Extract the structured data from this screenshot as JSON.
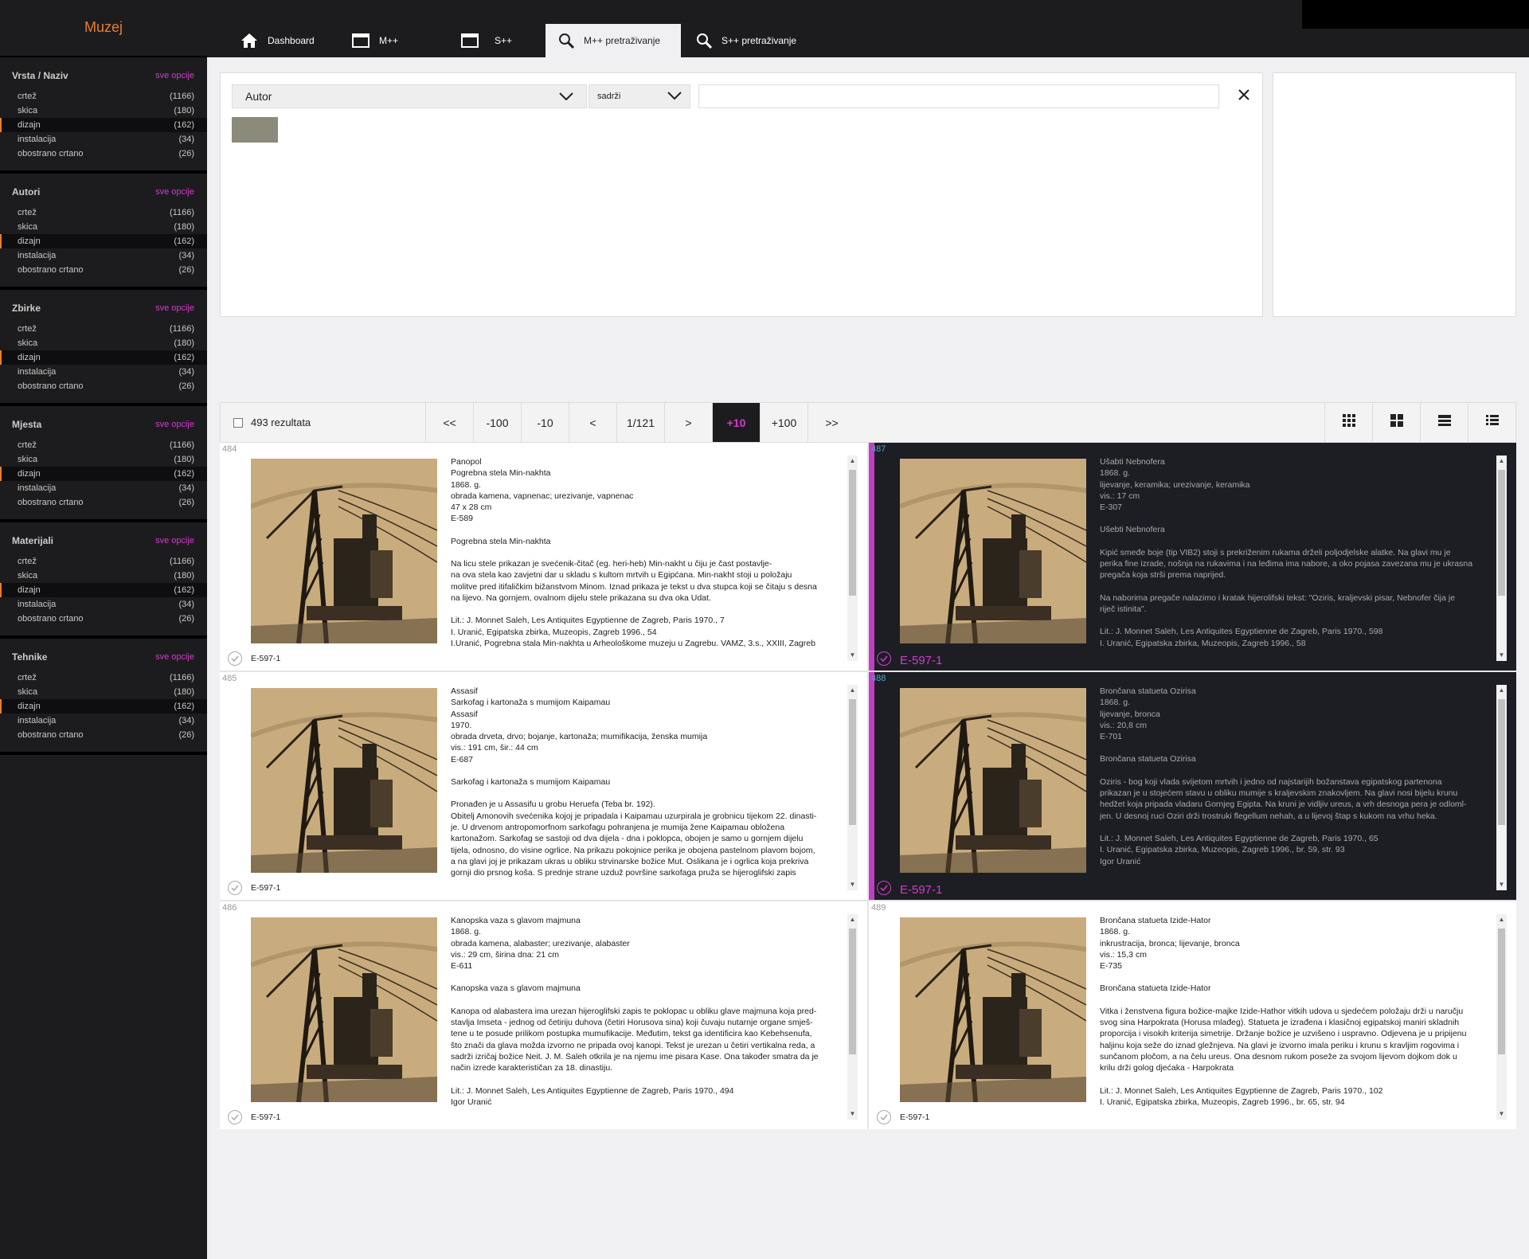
{
  "app": {
    "logo": "Muzej"
  },
  "tabs": [
    {
      "label": "Dashboard",
      "icon": "home-icon"
    },
    {
      "label": "M++",
      "icon": "window-icon"
    },
    {
      "label": "S++",
      "icon": "window-icon"
    },
    {
      "label": "M++ pretraživanje",
      "icon": "search-icon",
      "active": true
    },
    {
      "label": "S++ pretraživanje",
      "icon": "search-icon"
    }
  ],
  "filters": [
    {
      "title": "Vrsta / Naziv",
      "more": "sve opcije",
      "items": [
        {
          "label": "crtež",
          "count": "(1166)"
        },
        {
          "label": "skica",
          "count": "(180)"
        },
        {
          "label": "dizajn",
          "count": "(162)",
          "selected": true
        },
        {
          "label": "instalacija",
          "count": "(34)"
        },
        {
          "label": "obostrano crtano",
          "count": "(26)"
        }
      ]
    },
    {
      "title": "Autori",
      "more": "sve opcije",
      "items": [
        {
          "label": "crtež",
          "count": "(1166)"
        },
        {
          "label": "skica",
          "count": "(180)"
        },
        {
          "label": "dizajn",
          "count": "(162)",
          "selected": true
        },
        {
          "label": "instalacija",
          "count": "(34)"
        },
        {
          "label": "obostrano crtano",
          "count": "(26)"
        }
      ]
    },
    {
      "title": "Zbirke",
      "more": "sve opcije",
      "items": [
        {
          "label": "crtež",
          "count": "(1166)"
        },
        {
          "label": "skica",
          "count": "(180)"
        },
        {
          "label": "dizajn",
          "count": "(162)",
          "selected": true
        },
        {
          "label": "instalacija",
          "count": "(34)"
        },
        {
          "label": "obostrano crtano",
          "count": "(26)"
        }
      ]
    },
    {
      "title": "Mjesta",
      "more": "sve opcije",
      "items": [
        {
          "label": "crtež",
          "count": "(1166)"
        },
        {
          "label": "skica",
          "count": "(180)"
        },
        {
          "label": "dizajn",
          "count": "(162)",
          "selected": true
        },
        {
          "label": "instalacija",
          "count": "(34)"
        },
        {
          "label": "obostrano crtano",
          "count": "(26)"
        }
      ]
    },
    {
      "title": "Materijali",
      "more": "sve opcije",
      "items": [
        {
          "label": "crtež",
          "count": "(1166)"
        },
        {
          "label": "skica",
          "count": "(180)"
        },
        {
          "label": "dizajn",
          "count": "(162)",
          "selected": true
        },
        {
          "label": "instalacija",
          "count": "(34)"
        },
        {
          "label": "obostrano crtano",
          "count": "(26)"
        }
      ]
    },
    {
      "title": "Tehnike",
      "more": "sve opcije",
      "items": [
        {
          "label": "crtež",
          "count": "(1166)"
        },
        {
          "label": "skica",
          "count": "(180)"
        },
        {
          "label": "dizajn",
          "count": "(162)",
          "selected": true
        },
        {
          "label": "instalacija",
          "count": "(34)"
        },
        {
          "label": "obostrano crtano",
          "count": "(26)"
        }
      ]
    }
  ],
  "query": {
    "field": "Autor",
    "operator": "sadrži",
    "value": ""
  },
  "results": {
    "count_label": "493 rezultata",
    "pager": [
      {
        "label": "<<"
      },
      {
        "label": "-100"
      },
      {
        "label": "-10"
      },
      {
        "label": "<"
      },
      {
        "label": "1/121"
      },
      {
        "label": ">"
      },
      {
        "label": "+10",
        "active": true
      },
      {
        "label": "+100"
      },
      {
        "label": ">>"
      }
    ],
    "view_icons": [
      "grid-small-icon",
      "grid-large-icon",
      "list-icon",
      "detail-list-icon"
    ],
    "cards": [
      {
        "num": "484",
        "code": "E-597-1",
        "dark": false,
        "lines": [
          "Panopol",
          "Pogrebna stela Min-nakhta",
          "1868. g.",
          "obrada kamena, vapnenac; urezivanje, vapnenac",
          "47 x 28 cm",
          "E-589",
          "",
          "Pogrebna stela Min-nakhta",
          "",
          "Na licu stele prikazan je svećenik-čitač (eg. heri-heb) Min-nakht u čiju je čast postavlje-",
          "na ova stela kao zavjetni dar u skladu s kultom mrtvih u Egipćana. Min-nakht stoji u položaju",
          "molitve pred itifaličkim bižanstvom Minom. Iznad prikaza je tekst u dva stupca koji se čitaju s desna",
          "na lijevo. Na gornjem, ovalnom dijelu stele prikazana su dva oka Udat.",
          "",
          "Lit.: J. Monnet Saleh, Les Antiquites Egyptienne de Zagreb, Paris 1970., 7",
          "I. Uranić, Egipatska zbirka, Muzeopis, Zagreb 1996., 54",
          "I.Uranić, Pogrebna stala Min-nakhta u Arheološkome muzeju u Zagrebu. VAMZ, 3.s., XXIII, Zagreb"
        ]
      },
      {
        "num": "487",
        "code": "E-597-1",
        "dark": true,
        "lines": [
          "Ušabti Nebnofera",
          "1868. g.",
          "lijevanje, keramika; urezivanje, keramika",
          "vis.: 17 cm",
          "E-307",
          "",
          "Ušebti Nebnofera",
          "",
          "Kipić smeđe boje (tip VIB2) stoji s prekriženim rukama drželi poljodjelske alatke. Na glavi mu je",
          "perika fine izrade, nošnja na rukavima i na leđima ima nabore, a oko pojasa zavezana mu je ukrasna",
          "pregača koja strši prema naprijed.",
          "",
          "Na naborima pregače nalazimo i kratak hijerolifski tekst: \"Oziris, kraljevski pisar, Nebnofer čija je",
          "riječ istinita\".",
          "",
          "Lit.: J. Monnet Saleh, Les Antiquites Egyptienne de Zagreb, Paris 1970., 598",
          "I. Uranić, Egipatska zbirka, Muzeopis, Zagreb 1996., 58"
        ]
      },
      {
        "num": "485",
        "code": "E-597-1",
        "dark": false,
        "lines": [
          "Assasif",
          "Sarkofag i kartonaža s mumijom Kaipamau",
          "Assasif",
          "1970.",
          "obrada drveta, drvo; bojanje, kartonaža; mumifikacija, ženska mumija",
          "vis.: 191 cm, šir.: 44 cm",
          "E-687",
          "",
          "Sarkofag i kartonaža s mumijom Kaipamau",
          "",
          "Pronađen je u Assasifu u grobu Heruefa (Teba br. 192).",
          "Obitelj Amonovih svećenika kojoj je pripadala i Kaipamau uzurpirala je grobnicu tijekom 22. dinasti-",
          "je. U drvenom antropomorfnom sarkofagu pohranjena je mumija žene Kaipamau obložena",
          "kartonažom. Sarkofag se sastoji od dva dijela - dna i poklopca, obojen je samo u gornjem dijelu",
          "tijela, odnosno, do visine ogrlice. Na prikazu pokojnice perika je obojena pastelnom plavom bojom,",
          "a na glavi joj je prikazam ukras u obliku strvinarske božice Mut. Oslikana je i ogrlica koja prekriva",
          "gornji dio prsnog koša. S prednje strane uzduž površine sarkofaga pruža se hijeroglifski zapis"
        ]
      },
      {
        "num": "488",
        "code": "E-597-1",
        "dark": true,
        "lines": [
          "Brončana statueta Ozirisa",
          "1868. g.",
          "lijevanje, bronca",
          "vis.: 20,8 cm",
          "E-701",
          "",
          "Brončana statueta Ozirisa",
          "",
          "Oziris - bog koji vlada svijetom mrtvih i jedno od najstarijih božanstava egipatskog partenona",
          "prikazan je u stojećem stavu u obliku mumije s kraljevskim znakovljem. Na glavi nosi bijelu krunu",
          "hedžet koja pripada vladaru Gornjeg Egipta. Na kruni je vidljiv ureus, a vrh desnoga pera je odloml-",
          "jen. U desnoj ruci Oziri drži trostruki flegellum nehah, a u lijevoj štap s kukom na vrhu heka.",
          "",
          "Lit.: J. Monnet Saleh, Les Antiquites Egyptienne de Zagreb, Paris 1970., 65",
          "I. Uranić, Egipatska zbirka, Muzeopis, Zagreb 1996., br. 59, str. 93",
          "Igor Uranić"
        ]
      },
      {
        "num": "486",
        "code": "E-597-1",
        "dark": false,
        "lines": [
          "Kanopska vaza s glavom majmuna",
          "1868. g.",
          "obrada kamena, alabaster; urezivanje, alabaster",
          "vis.: 29 cm, širina dna: 21 cm",
          "E-611",
          "",
          "Kanopska vaza s glavom majmuna",
          "",
          "Kanopa od alabastera ima urezan hijeroglifski zapis te poklopac u obliku glave majmuna koja pred-",
          "stavlja Imseta - jednog od četiriju duhova (četiri Horusova sina) koji čuvaju nutarnje organe smješ-",
          "tene u te posude prilikom postupka mumufikacije. Međutim, tekst ga identificira kao Kebehsenufa,",
          "što znači da glava možda izvorno ne pripada ovoj kanopi. Tekst je urezan u četiri vertikalna reda, a",
          "sadrži izričaj božice Neit. J. M. Saleh otkrila je na njemu ime pisara Kase. Ona također smatra da je",
          "način izrede karakterističan za 18. dinastiju.",
          "",
          "Lit.: J. Monnet Saleh, Les Antiquites Egyptienne de Zagreb, Paris 1970., 494",
          "Igor Uranić"
        ]
      },
      {
        "num": "489",
        "code": "E-597-1",
        "dark": false,
        "lines": [
          "Brončana statueta Izide-Hator",
          "1868. g.",
          "inkrustracija, bronca; lijevanje, bronca",
          "vis.: 15,3 cm",
          "E-735",
          "",
          "Brončana statueta Izide-Hator",
          "",
          "Vitka i ženstvena figura božice-majke Izide-Hathor vitkih udova u sjedećem položaju drži u naručju",
          "svog sina Harpokrata (Horusa mlađeg). Statueta je izrađena i klasičnoj egipatskoj maniri skladnih",
          "proporcija i visokih kriterija simetrije. Držanje božice je uzvišeno i uspravno. Odjevena je u pripijenu",
          "haljinu koja seže do iznad gležnjeva. Na glavi je izvorno imala periku i krunu s kravljim rogovima i",
          "sunčanom pločom, a na čelu ureus. Ona desnom rukom poseže za svojom lijevom dojkom dok u",
          "krilu drži golog djećaka - Harpokrata",
          "",
          "Lit.: J. Monnet Saleh, Les Antiquites Egyptienne de Zagreb, Paris 1970., 102",
          "I. Uranić, Egipatska zbirka, Muzeopis, Zagreb 1996., br. 65, str. 94"
        ]
      }
    ]
  },
  "colors": {
    "accent": "#c13ec2",
    "link": "#d13ccb",
    "logo": "#e87d2a",
    "dark": "#1c1c1e"
  }
}
